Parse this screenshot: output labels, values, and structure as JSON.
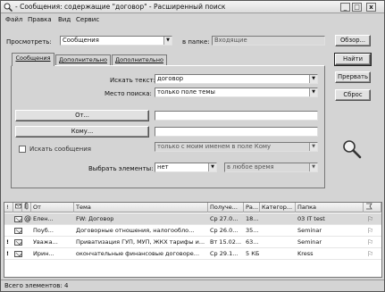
{
  "window": {
    "title": "- Сообщения: содержащие \"договор\" - Расширенный поиск"
  },
  "menu": [
    "Файл",
    "Правка",
    "Вид",
    "Сервис"
  ],
  "top": {
    "look_label": "Просмотреть:",
    "look_value": "Сообщения",
    "folder_label": "в папке:",
    "folder_value": "Входящие"
  },
  "buttons": {
    "browse": "Обзор...",
    "find": "Найти",
    "stop": "Прервать",
    "reset": "Сброс"
  },
  "tabs": [
    "Сообщения",
    "Дополнительно",
    "Дополнительно"
  ],
  "form": {
    "search_text_label": "Искать текст:",
    "search_text_value": "договор",
    "search_where_label": "Место поиска:",
    "search_where_value": "только поле темы",
    "from_button": "От...",
    "to_button": "Кому...",
    "only_items_label": "Искать сообщения",
    "recipient_value": "только с моим именем в поле Кому",
    "time_label": "Выбрать элементы:",
    "time_field_value": "нет",
    "time_range_value": "в любое время"
  },
  "table": {
    "columns": [
      "!",
      "",
      "",
      "От",
      "Тема",
      "Получе...",
      "Ра...",
      "Категор...",
      "Папка",
      ""
    ],
    "rows": [
      {
        "importance": "",
        "from": "Елен...",
        "subject": "FW: Договор",
        "received": "Ср 27.0...",
        "size": "18...",
        "category": "",
        "folder": "03 IT test",
        "selected": true
      },
      {
        "importance": "",
        "from": "Поуб...",
        "subject": "Договорные отношения, налогообло...",
        "received": "Ср 26.0...",
        "size": "35...",
        "category": "",
        "folder": "Seminar",
        "selected": false
      },
      {
        "importance": "!",
        "from": "Уважа...",
        "subject": "Приватизация ГУП, МУП, ЖКХ тарифы и...",
        "received": "Вт 15.02...",
        "size": "63...",
        "category": "",
        "folder": "Seminar",
        "selected": false
      },
      {
        "importance": "!",
        "from": "Ирин...",
        "subject": "окончательные финансовые договоре...",
        "received": "Ср 29.1...",
        "size": "5 КБ",
        "category": "",
        "folder": "Kress",
        "selected": false
      }
    ]
  },
  "status": "Всего элементов: 4"
}
